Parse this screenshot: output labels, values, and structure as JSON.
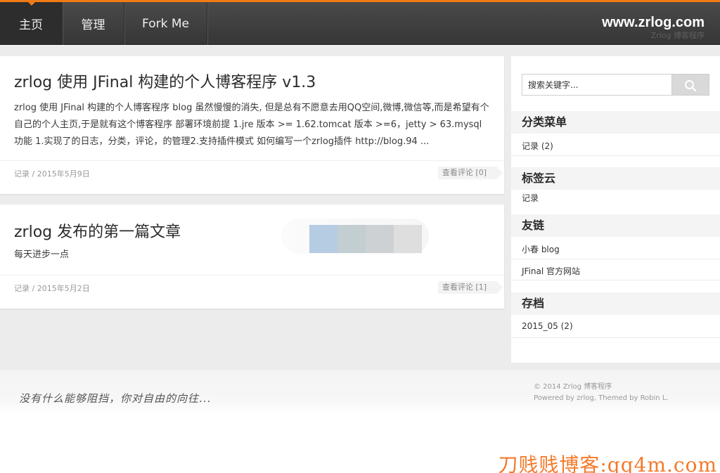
{
  "header": {
    "nav": [
      {
        "label": "主页"
      },
      {
        "label": "管理"
      },
      {
        "label": "Fork Me"
      }
    ],
    "brand_title": "www.zrlog.com",
    "brand_subtitle": "Zrlog 博客程序"
  },
  "posts": [
    {
      "title": "zrlog 使用 JFinal 构建的个人博客程序 v1.3",
      "excerpt": "zrlog 使用 JFinal 构建的个人博客程序 blog 虽然慢慢的消失, 但是总有不愿意去用QQ空间,微博,微信等,而是希望有个自己的个人主页,于是就有这个博客程序 部署环境前提 1.jre 版本 >= 1.62.tomcat 版本 >=6，jetty > 63.mysql 功能 1.实现了的日志，分类，评论，的管理2.支持插件模式 如何编写一个zrlog插件 http://blog.94 ...",
      "meta": "记录 / 2015年5月9日",
      "comments": "查看评论 [0]"
    },
    {
      "title": "zrlog 发布的第一篇文章",
      "excerpt": "每天进步一点",
      "meta": "记录 / 2015年5月2日",
      "comments": "查看评论 [1]",
      "swatch_colors": [
        "#b6cce2",
        "#c3ced2",
        "#cdd1d4",
        "#dedede"
      ]
    }
  ],
  "sidebar": {
    "search_placeholder": "搜索关键字...",
    "categories": {
      "title": "分类菜单",
      "items": [
        "记录 (2)"
      ]
    },
    "tags": {
      "title": "标签云",
      "items": [
        "记录"
      ]
    },
    "links": {
      "title": "友链",
      "items": [
        "小春 blog",
        "JFinal 官方网站"
      ]
    },
    "archives": {
      "title": "存档",
      "items": [
        "2015_05 (2)"
      ]
    }
  },
  "footer": {
    "motto": "没有什么能够阻挡，你对自由的向往...",
    "copyright_line1": "© 2014 Zrlog 博客程序",
    "copyright_line2": "Powered by zrlog, Themed by Robin L."
  },
  "watermark": "刀贱贱博客:qq4m.com",
  "colors": {
    "accent": "#f07a14",
    "header_bg": "#3f3f3f",
    "watermark": "#f47a2a"
  }
}
